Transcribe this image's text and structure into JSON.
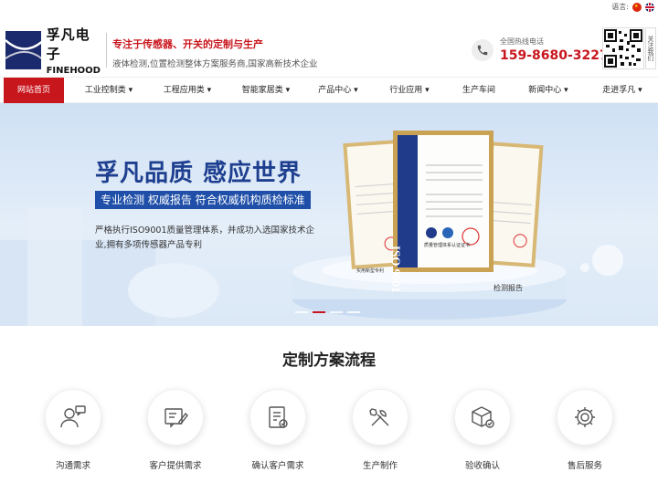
{
  "topbar": {
    "lang_label": "语言:"
  },
  "brand": {
    "name_cn": "孚凡电子",
    "name_en": "FINEHOOD"
  },
  "slogan": {
    "main": "专注于传感器、开关的定制与生产",
    "sub": "液体检测,位置检测整体方案服务商,国家高新技术企业"
  },
  "hotline": {
    "label": "全国热线电话",
    "number": "159-8680-3227"
  },
  "follow": {
    "label": "关注我们"
  },
  "nav": {
    "items": [
      {
        "label": "网站首页",
        "active": true
      },
      {
        "label": "工业控制类 ▾"
      },
      {
        "label": "工程应用类 ▾"
      },
      {
        "label": "智能家居类 ▾"
      },
      {
        "label": "产品中心 ▾"
      },
      {
        "label": "行业应用 ▾"
      },
      {
        "label": "生产车间"
      },
      {
        "label": "新闻中心 ▾"
      },
      {
        "label": "走进孚凡 ▾"
      }
    ]
  },
  "banner": {
    "title": "孚凡品质  感应世界",
    "tag": "专业检测 权威报告 符合权威机构质检标准",
    "desc": "严格执行ISO9001质量管理体系，并成功入选国家技术企业,拥有多项传感器产品专利",
    "cert_center": "ISO 9001",
    "cert_center_head": "质量管理体系认证证书",
    "cert_left": "实用新型专利",
    "cert_right": "检测报告",
    "slides": 4,
    "active_slide": 2
  },
  "process": {
    "title": "定制方案流程",
    "steps": [
      {
        "label": "沟通需求",
        "icon": "chat-user-icon"
      },
      {
        "label": "客户提供需求",
        "icon": "document-edit-icon"
      },
      {
        "label": "确认客户需求",
        "icon": "checklist-icon"
      },
      {
        "label": "生产制作",
        "icon": "tools-icon"
      },
      {
        "label": "验收确认",
        "icon": "box-check-icon"
      },
      {
        "label": "售后服务",
        "icon": "gear-service-icon"
      }
    ]
  },
  "colors": {
    "brand_red": "#c8161d",
    "brand_blue": "#1e3f8f",
    "logo_navy": "#1a2a6c"
  }
}
